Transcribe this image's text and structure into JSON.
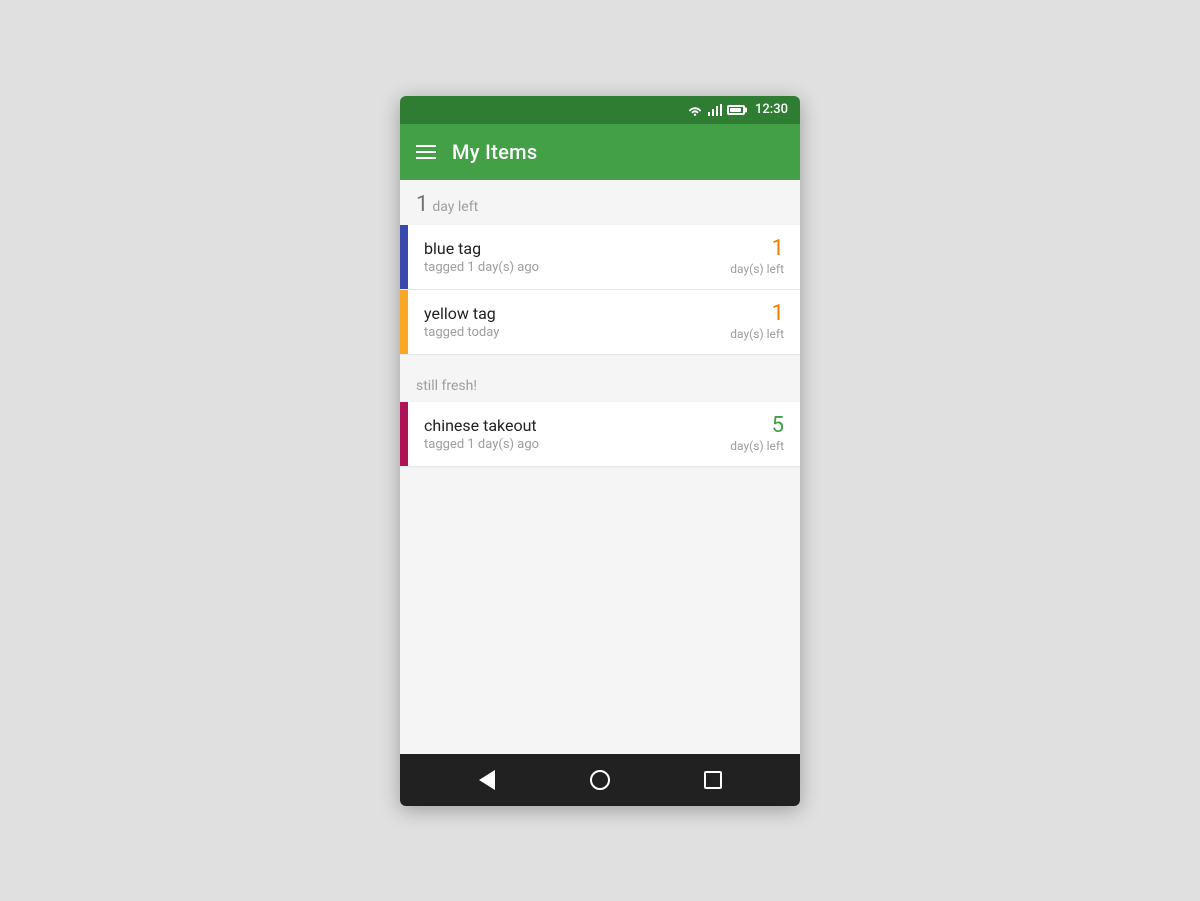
{
  "statusBar": {
    "time": "12:30"
  },
  "appBar": {
    "title": "My Items",
    "menuIcon": "hamburger-menu"
  },
  "sections": [
    {
      "id": "expiring",
      "countLabel": "1",
      "label": "day left",
      "items": [
        {
          "id": "blue-tag",
          "name": "blue tag",
          "tagColor": "#3949ab",
          "taggedText": "tagged 1 day(s) ago",
          "daysCount": "1",
          "daysLabel": "day(s) left",
          "daysStatus": "warning"
        },
        {
          "id": "yellow-tag",
          "name": "yellow tag",
          "tagColor": "#f9a825",
          "taggedText": "tagged today",
          "daysCount": "1",
          "daysLabel": "day(s) left",
          "daysStatus": "warning"
        }
      ]
    },
    {
      "id": "fresh",
      "countLabel": "",
      "label": "still fresh!",
      "items": [
        {
          "id": "chinese-takeout",
          "name": "chinese takeout",
          "tagColor": "#ad1457",
          "taggedText": "tagged 1 day(s) ago",
          "daysCount": "5",
          "daysLabel": "day(s) left",
          "daysStatus": "fresh"
        }
      ]
    }
  ],
  "navBar": {
    "backLabel": "back",
    "homeLabel": "home",
    "recentsLabel": "recents"
  }
}
